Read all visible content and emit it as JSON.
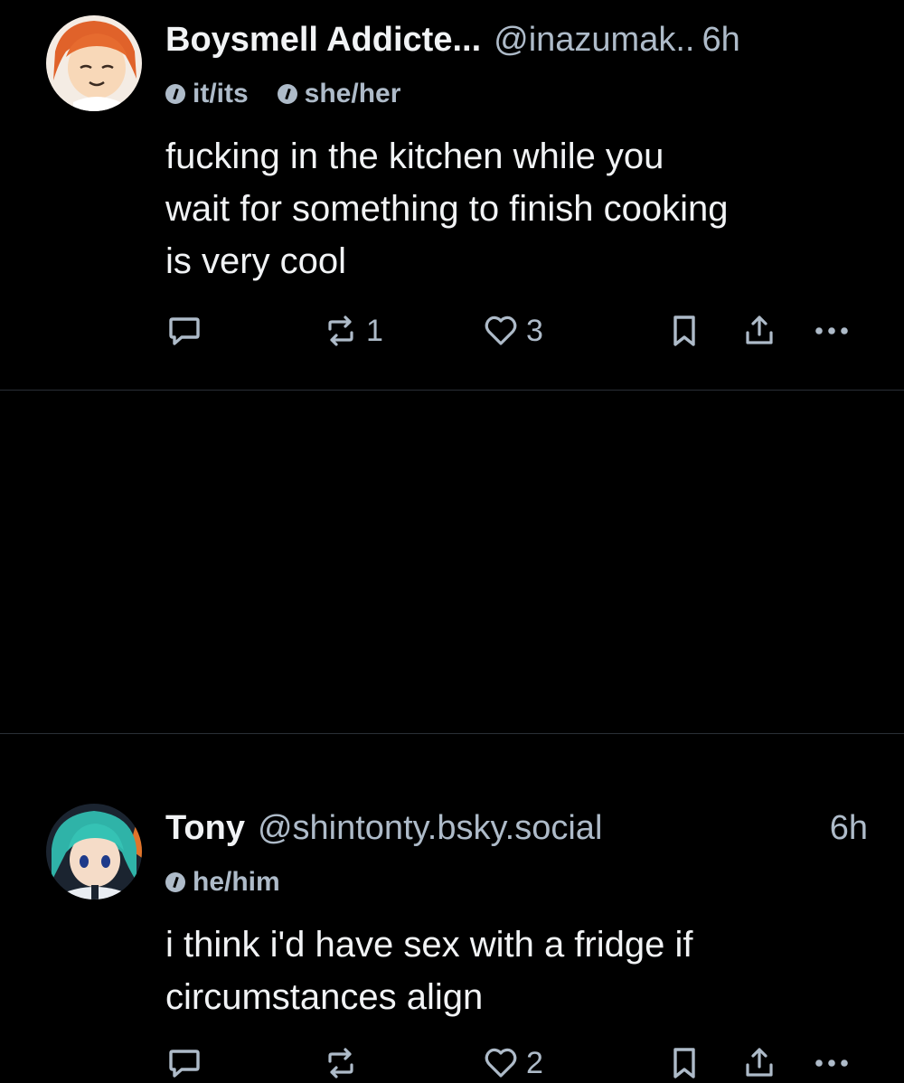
{
  "posts": [
    {
      "display_name": "Boysmell Addicte...",
      "handle": "@inazumak..",
      "time": "6h",
      "pronouns": [
        "it/its",
        "she/her"
      ],
      "text": "fucking in the kitchen while you\nwait for something to finish cooking\nis very cool",
      "reply_count": "",
      "repost_count": "1",
      "like_count": "3"
    },
    {
      "display_name": "Tony",
      "handle": "@shintonty.bsky.social",
      "time": "6h",
      "pronouns": [
        "he/him"
      ],
      "text": "i think i'd have sex with a fridge if\ncircumstances align",
      "reply_count": "",
      "repost_count": "",
      "like_count": "2"
    }
  ],
  "icons": {
    "reply": "speech-bubble-icon",
    "repost": "repost-arrows-icon",
    "like": "heart-icon",
    "bookmark": "bookmark-icon",
    "share": "share-icon",
    "more": "more-dots-icon",
    "pronoun": "pronoun-info-icon"
  },
  "colors": {
    "background": "#000000",
    "primary_text": "#f1f3f5",
    "secondary_text": "#aebbc9",
    "divider": "#2a2f36"
  }
}
